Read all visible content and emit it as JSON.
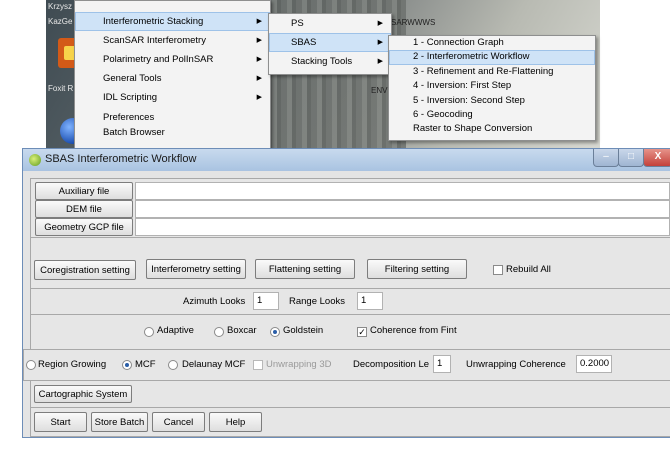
{
  "desktop": {
    "icon_labels": [
      "Krzysz",
      "KazGe",
      "Foxit R"
    ],
    "bg_texts": [
      "SARWWWS",
      "ENVI"
    ]
  },
  "menu_level1": {
    "items": [
      {
        "label": "Interferometric Stacking",
        "submenu": true,
        "selected": true
      },
      {
        "label": "ScanSAR Interferometry",
        "submenu": true
      },
      {
        "label": "Polarimetry and PolInSAR",
        "submenu": true
      },
      {
        "label": "General Tools",
        "submenu": true
      },
      {
        "label": "IDL Scripting",
        "submenu": true
      },
      {
        "label": "Preferences",
        "submenu": false
      },
      {
        "label": "Batch Browser",
        "submenu": false
      }
    ]
  },
  "menu_level2": {
    "items": [
      {
        "label": "PS",
        "submenu": true
      },
      {
        "label": "SBAS",
        "submenu": true,
        "selected": true
      },
      {
        "label": "Stacking Tools",
        "submenu": true
      }
    ]
  },
  "menu_level3": {
    "items": [
      {
        "label": "1 - Connection Graph"
      },
      {
        "label": "2 - Interferometric Workflow",
        "selected": true
      },
      {
        "label": "3 - Refinement and Re-Flattening"
      },
      {
        "label": "4 - Inversion: First Step"
      },
      {
        "label": "5 - Inversion: Second Step"
      },
      {
        "label": "6 - Geocoding"
      },
      {
        "label": "Raster to Shape Conversion"
      }
    ]
  },
  "window": {
    "title": "SBAS Interferometric Workflow",
    "controls": {
      "minimize": "–",
      "maximize": "□",
      "close": "X"
    }
  },
  "inputs": {
    "auxiliary_label": "Auxiliary file",
    "auxiliary_value": "",
    "dem_label": "DEM file",
    "dem_value": "",
    "geometry_label": "Geometry GCP file",
    "geometry_value": ""
  },
  "settings": {
    "coregistration": "Coregistration setting",
    "interferometry": "Interferometry setting",
    "flattening": "Flattening setting",
    "filtering": "Filtering setting",
    "rebuild_all": "Rebuild All"
  },
  "looks": {
    "azimuth_label": "Azimuth Looks",
    "azimuth_value": "1",
    "range_label": "Range Looks",
    "range_value": "1"
  },
  "filter": {
    "adaptive": "Adaptive",
    "boxcar": "Boxcar",
    "goldstein": "Goldstein",
    "selected": "goldstein",
    "coherence_label": "Coherence from Fint",
    "coherence_checked": true
  },
  "unwrap": {
    "region_growing": "Region Growing",
    "mcf": "MCF",
    "delaunay": "Delaunay MCF",
    "selected": "mcf",
    "unwrapping3d": "Unwrapping 3D",
    "decomposition_label": "Decomposition Le",
    "decomposition_value": "1",
    "coherence_label": "Unwrapping Coherence",
    "coherence_value": "0.2000"
  },
  "cartographic": {
    "label": "Cartographic System"
  },
  "footer": {
    "start": "Start",
    "store_batch": "Store Batch",
    "cancel": "Cancel",
    "help": "Help"
  }
}
